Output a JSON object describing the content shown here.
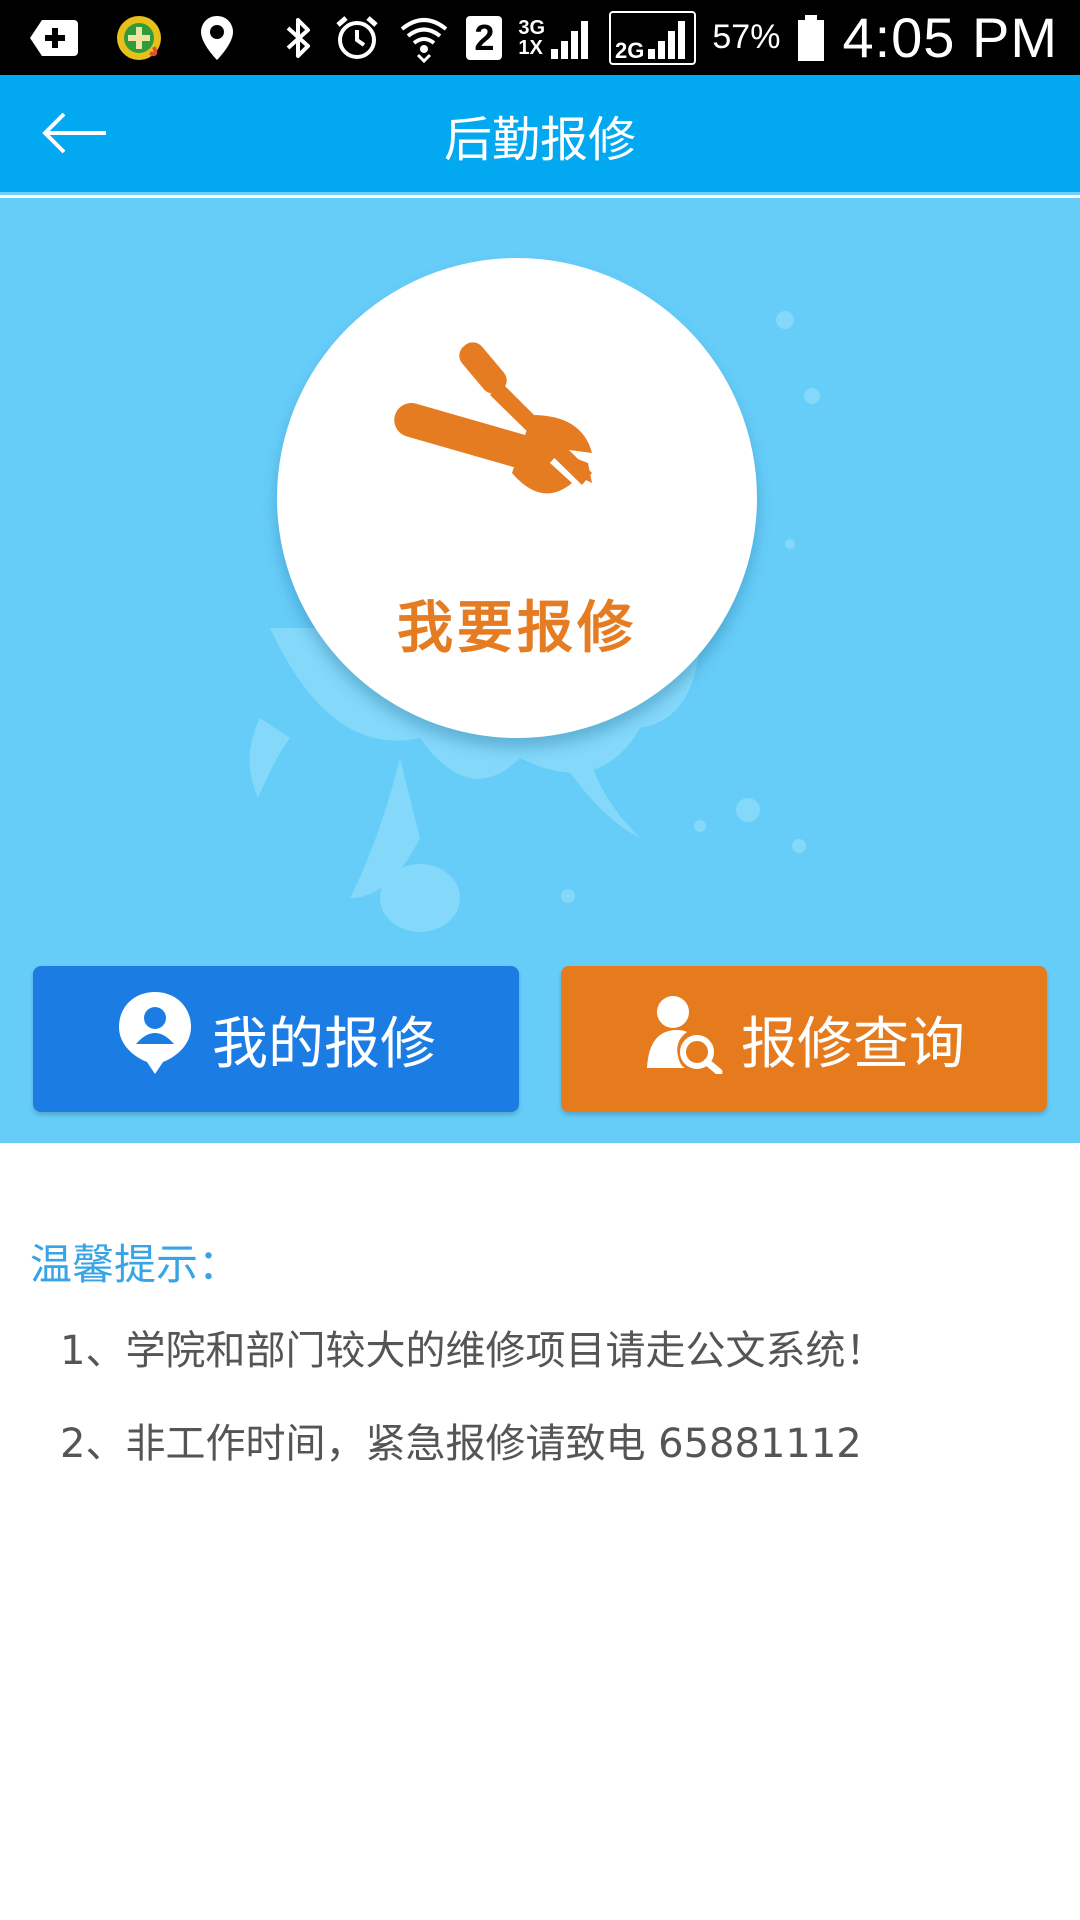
{
  "status_bar": {
    "notification_badge": "2",
    "network_3g": "3G",
    "network_1x": "1X",
    "network_2g": "2G",
    "battery_percent": "57%",
    "time": "4:05 PM",
    "icons": [
      "add-box-icon",
      "game-app-icon",
      "location-icon",
      "bluetooth-icon",
      "alarm-icon",
      "wifi-icon",
      "signal-icon",
      "battery-icon"
    ]
  },
  "header": {
    "title": "后勤报修",
    "back_icon": "arrow-left-icon"
  },
  "hero": {
    "main_button_label": "我要报修",
    "main_icon": "wrench-screwdriver-icon"
  },
  "actions": {
    "my_repairs_label": "我的报修",
    "my_repairs_icon": "user-pin-icon",
    "repair_query_label": "报修查询",
    "repair_query_icon": "user-search-icon"
  },
  "tips": {
    "title": "温馨提示：",
    "items": [
      "1、学院和部门较大的维修项目请走公文系统！",
      "2、非工作时间，紧急报修请致电 65881112"
    ]
  },
  "colors": {
    "title_bar": "#02a8f0",
    "hero_bg": "#66ccf8",
    "accent_orange": "#e67b1d",
    "accent_blue": "#1b7de3",
    "tips_title": "#38a4e6"
  }
}
